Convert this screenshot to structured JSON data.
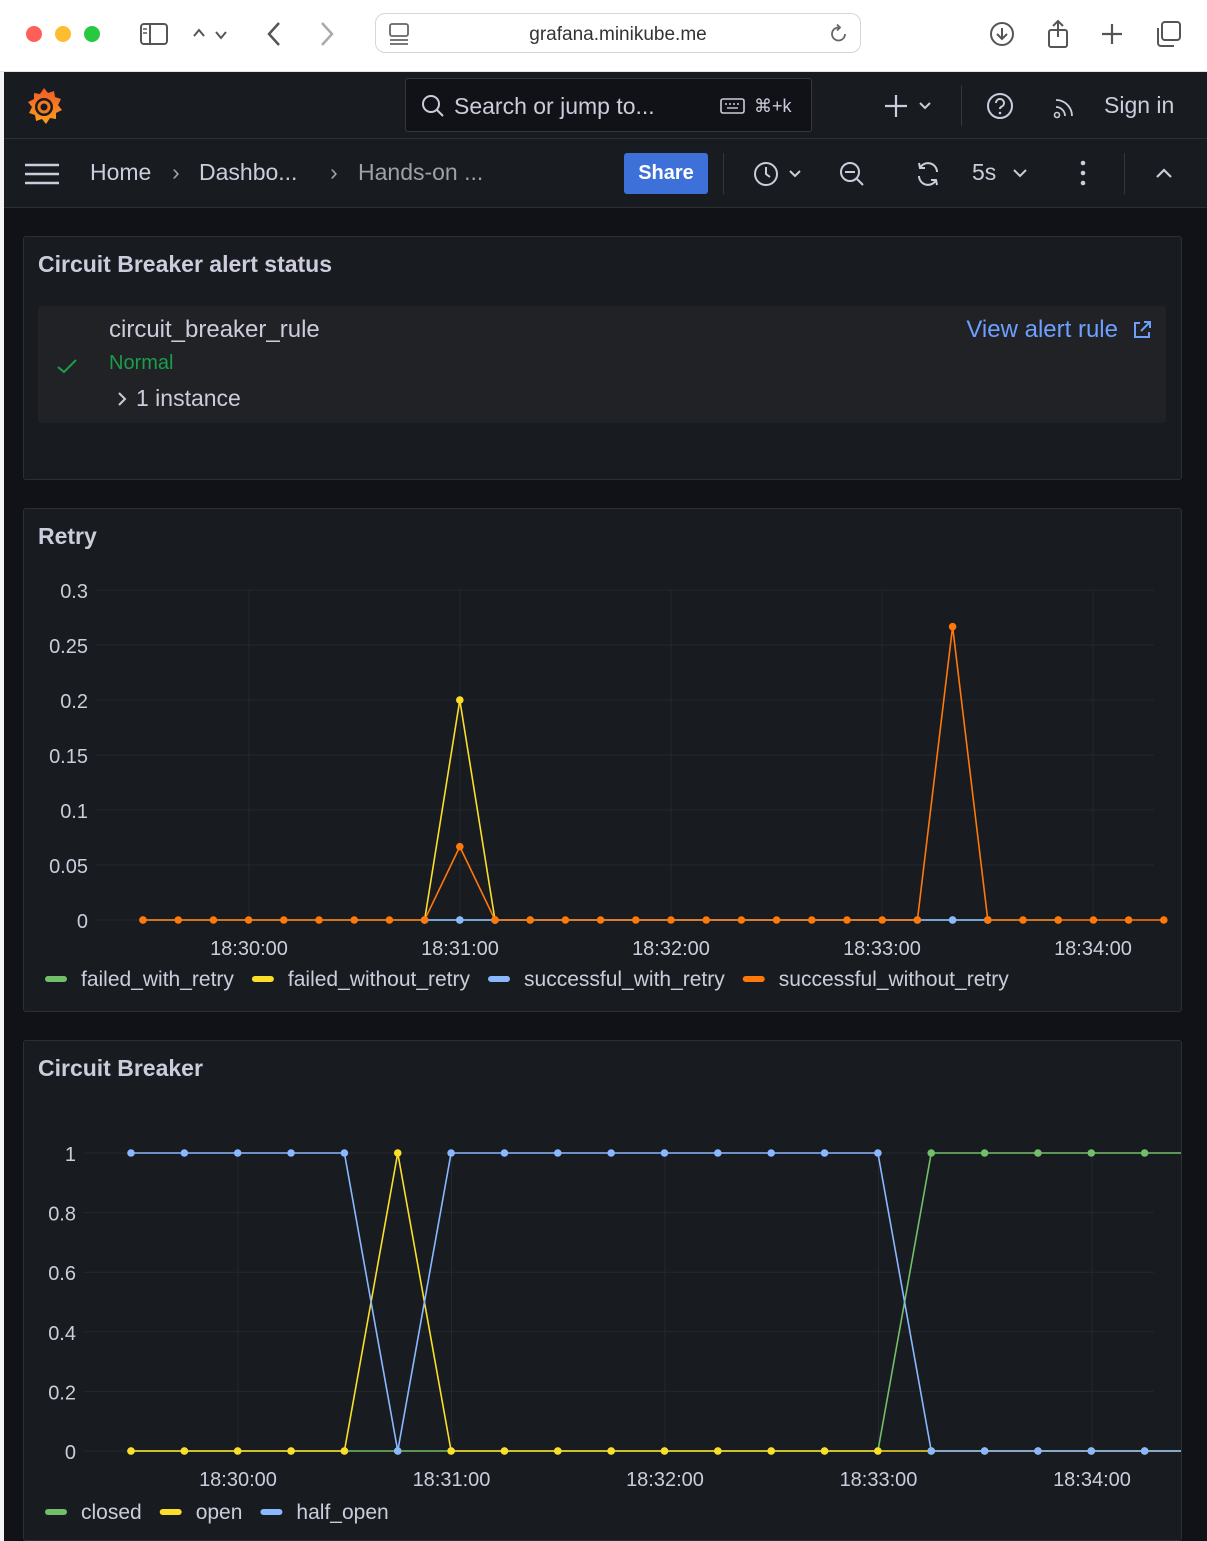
{
  "browser": {
    "url": "grafana.minikube.me"
  },
  "grafana": {
    "search_placeholder": "Search or jump to...",
    "search_shortcut": "⌘+k",
    "sign_in": "Sign in",
    "breadcrumbs": [
      "Home",
      "Dashbo...",
      "Hands-on ..."
    ],
    "share_label": "Share",
    "refresh_interval": "5s"
  },
  "alert_panel": {
    "title": "Circuit Breaker alert status",
    "rule_name": "circuit_breaker_rule",
    "state": "Normal",
    "instances": "1 instance",
    "view_link": "View alert rule"
  },
  "colors": {
    "green": "#73bf69",
    "yellow": "#fade2a",
    "blue": "#8ab8ff",
    "orange": "#ff780a"
  },
  "chart_data": [
    {
      "type": "line",
      "title": "Retry",
      "x": [
        "18:29:45",
        "18:29:50",
        "18:30:00",
        "18:30:10",
        "18:30:15",
        "18:30:40",
        "18:30:50",
        "18:31:00",
        "18:31:10",
        "18:31:20",
        "18:31:30",
        "18:31:40",
        "18:31:50",
        "18:32:00",
        "18:32:10",
        "18:32:20",
        "18:32:30",
        "18:32:40",
        "18:32:50",
        "18:33:00",
        "18:33:10",
        "18:33:20",
        "18:33:30",
        "18:33:40",
        "18:33:50",
        "18:34:00",
        "18:34:10"
      ],
      "x_ticks": [
        "18:30:00",
        "18:31:00",
        "18:32:00",
        "18:33:00",
        "18:34:00"
      ],
      "y_ticks": [
        "0",
        "0.05",
        "0.1",
        "0.15",
        "0.2",
        "0.25",
        "0.3"
      ],
      "ylim": [
        0,
        0.3
      ],
      "series": [
        {
          "name": "failed_with_retry",
          "color": "#73bf69",
          "points": [
            [
              0,
              0
            ],
            [
              180,
              0
            ],
            [
              200,
              0
            ],
            [
              220,
              0
            ],
            [
              460,
              0
            ],
            [
              480,
              0
            ],
            [
              520,
              0
            ]
          ]
        },
        {
          "name": "failed_without_retry",
          "color": "#fade2a",
          "points": [
            [
              160,
              0
            ],
            [
              180,
              0.2
            ],
            [
              200,
              0
            ]
          ]
        },
        {
          "name": "successful_with_retry",
          "color": "#8ab8ff",
          "points": [
            [
              160,
              0
            ],
            [
              180,
              0
            ],
            [
              200,
              0
            ],
            [
              440,
              0
            ],
            [
              460,
              0
            ],
            [
              480,
              0
            ]
          ]
        },
        {
          "name": "successful_without_retry",
          "color": "#ff780a",
          "points": [
            [
              0,
              0
            ],
            [
              20,
              0
            ],
            [
              40,
              0
            ],
            [
              60,
              0
            ],
            [
              80,
              0
            ],
            [
              100,
              0
            ],
            [
              120,
              0
            ],
            [
              140,
              0
            ],
            [
              160,
              0
            ],
            [
              180,
              0.0667
            ],
            [
              200,
              0
            ],
            [
              220,
              0
            ],
            [
              240,
              0
            ],
            [
              260,
              0
            ],
            [
              280,
              0
            ],
            [
              300,
              0
            ],
            [
              320,
              0
            ],
            [
              340,
              0
            ],
            [
              360,
              0
            ],
            [
              380,
              0
            ],
            [
              400,
              0
            ],
            [
              420,
              0
            ],
            [
              440,
              0
            ],
            [
              460,
              0.2667
            ],
            [
              480,
              0
            ],
            [
              500,
              0
            ],
            [
              520,
              0
            ],
            [
              540,
              0
            ],
            [
              560,
              0
            ],
            [
              580,
              0
            ]
          ]
        }
      ]
    },
    {
      "type": "line",
      "title": "Circuit Breaker",
      "x_ticks": [
        "18:30:00",
        "18:31:00",
        "18:32:00",
        "18:33:00",
        "18:34:00"
      ],
      "y_ticks": [
        "0",
        "0.2",
        "0.4",
        "0.6",
        "0.8",
        "1"
      ],
      "ylim": [
        0,
        1
      ],
      "series": [
        {
          "name": "closed",
          "color": "#73bf69",
          "values": [
            0,
            0,
            0,
            0,
            0,
            0,
            0,
            0,
            0,
            0,
            0,
            0,
            0,
            0,
            0,
            1,
            1,
            1,
            1,
            1,
            1
          ]
        },
        {
          "name": "open",
          "color": "#fade2a",
          "values": [
            0,
            0,
            0,
            0,
            0,
            1,
            0,
            0,
            0,
            0,
            0,
            0,
            0,
            0,
            0,
            0,
            0,
            0,
            0,
            0,
            0
          ]
        },
        {
          "name": "half_open",
          "color": "#8ab8ff",
          "values": [
            1,
            1,
            1,
            1,
            1,
            0,
            1,
            1,
            1,
            1,
            1,
            1,
            1,
            1,
            1,
            0,
            0,
            0,
            0,
            0,
            0
          ]
        }
      ]
    }
  ]
}
